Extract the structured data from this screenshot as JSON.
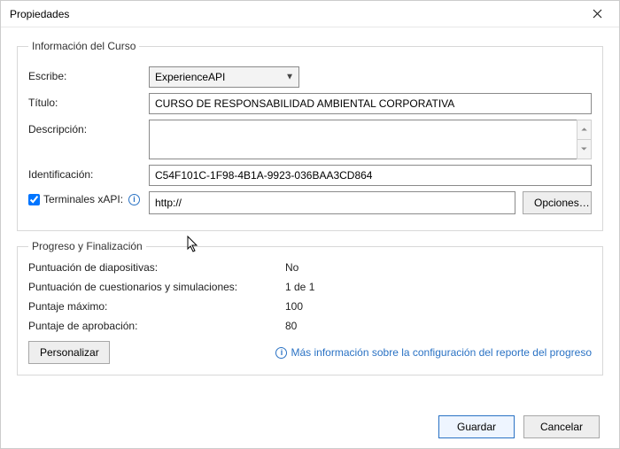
{
  "window": {
    "title": "Propiedades"
  },
  "fieldsets": {
    "info": "Información del Curso",
    "progress": "Progreso y Finalización"
  },
  "labels": {
    "escribe": "Escribe:",
    "titulo": "Título:",
    "descripcion": "Descripción:",
    "identificacion": "Identificación:",
    "xapi": "Terminales xAPI:"
  },
  "values": {
    "escribe": "ExperienceAPI",
    "titulo": "CURSO DE RESPONSABILIDAD AMBIENTAL CORPORATIVA",
    "descripcion": "",
    "identificacion": "C54F101C-1F98-4B1A-9923-036BAA3CD864",
    "xapi": "http://",
    "xapi_checked": true
  },
  "buttons": {
    "opciones": "Opciones…",
    "personalizar": "Personalizar",
    "guardar": "Guardar",
    "cancelar": "Cancelar"
  },
  "progress": {
    "slide_scoring_label": "Puntuación de diapositivas:",
    "slide_scoring_value": "No",
    "quiz_scoring_label": "Puntuación de cuestionarios y simulaciones:",
    "quiz_scoring_value": "1 de 1",
    "max_label": "Puntaje máximo:",
    "max_value": "100",
    "pass_label": "Puntaje de aprobación:",
    "pass_value": "80"
  },
  "link": "Más información sobre la configuración del reporte del progreso"
}
